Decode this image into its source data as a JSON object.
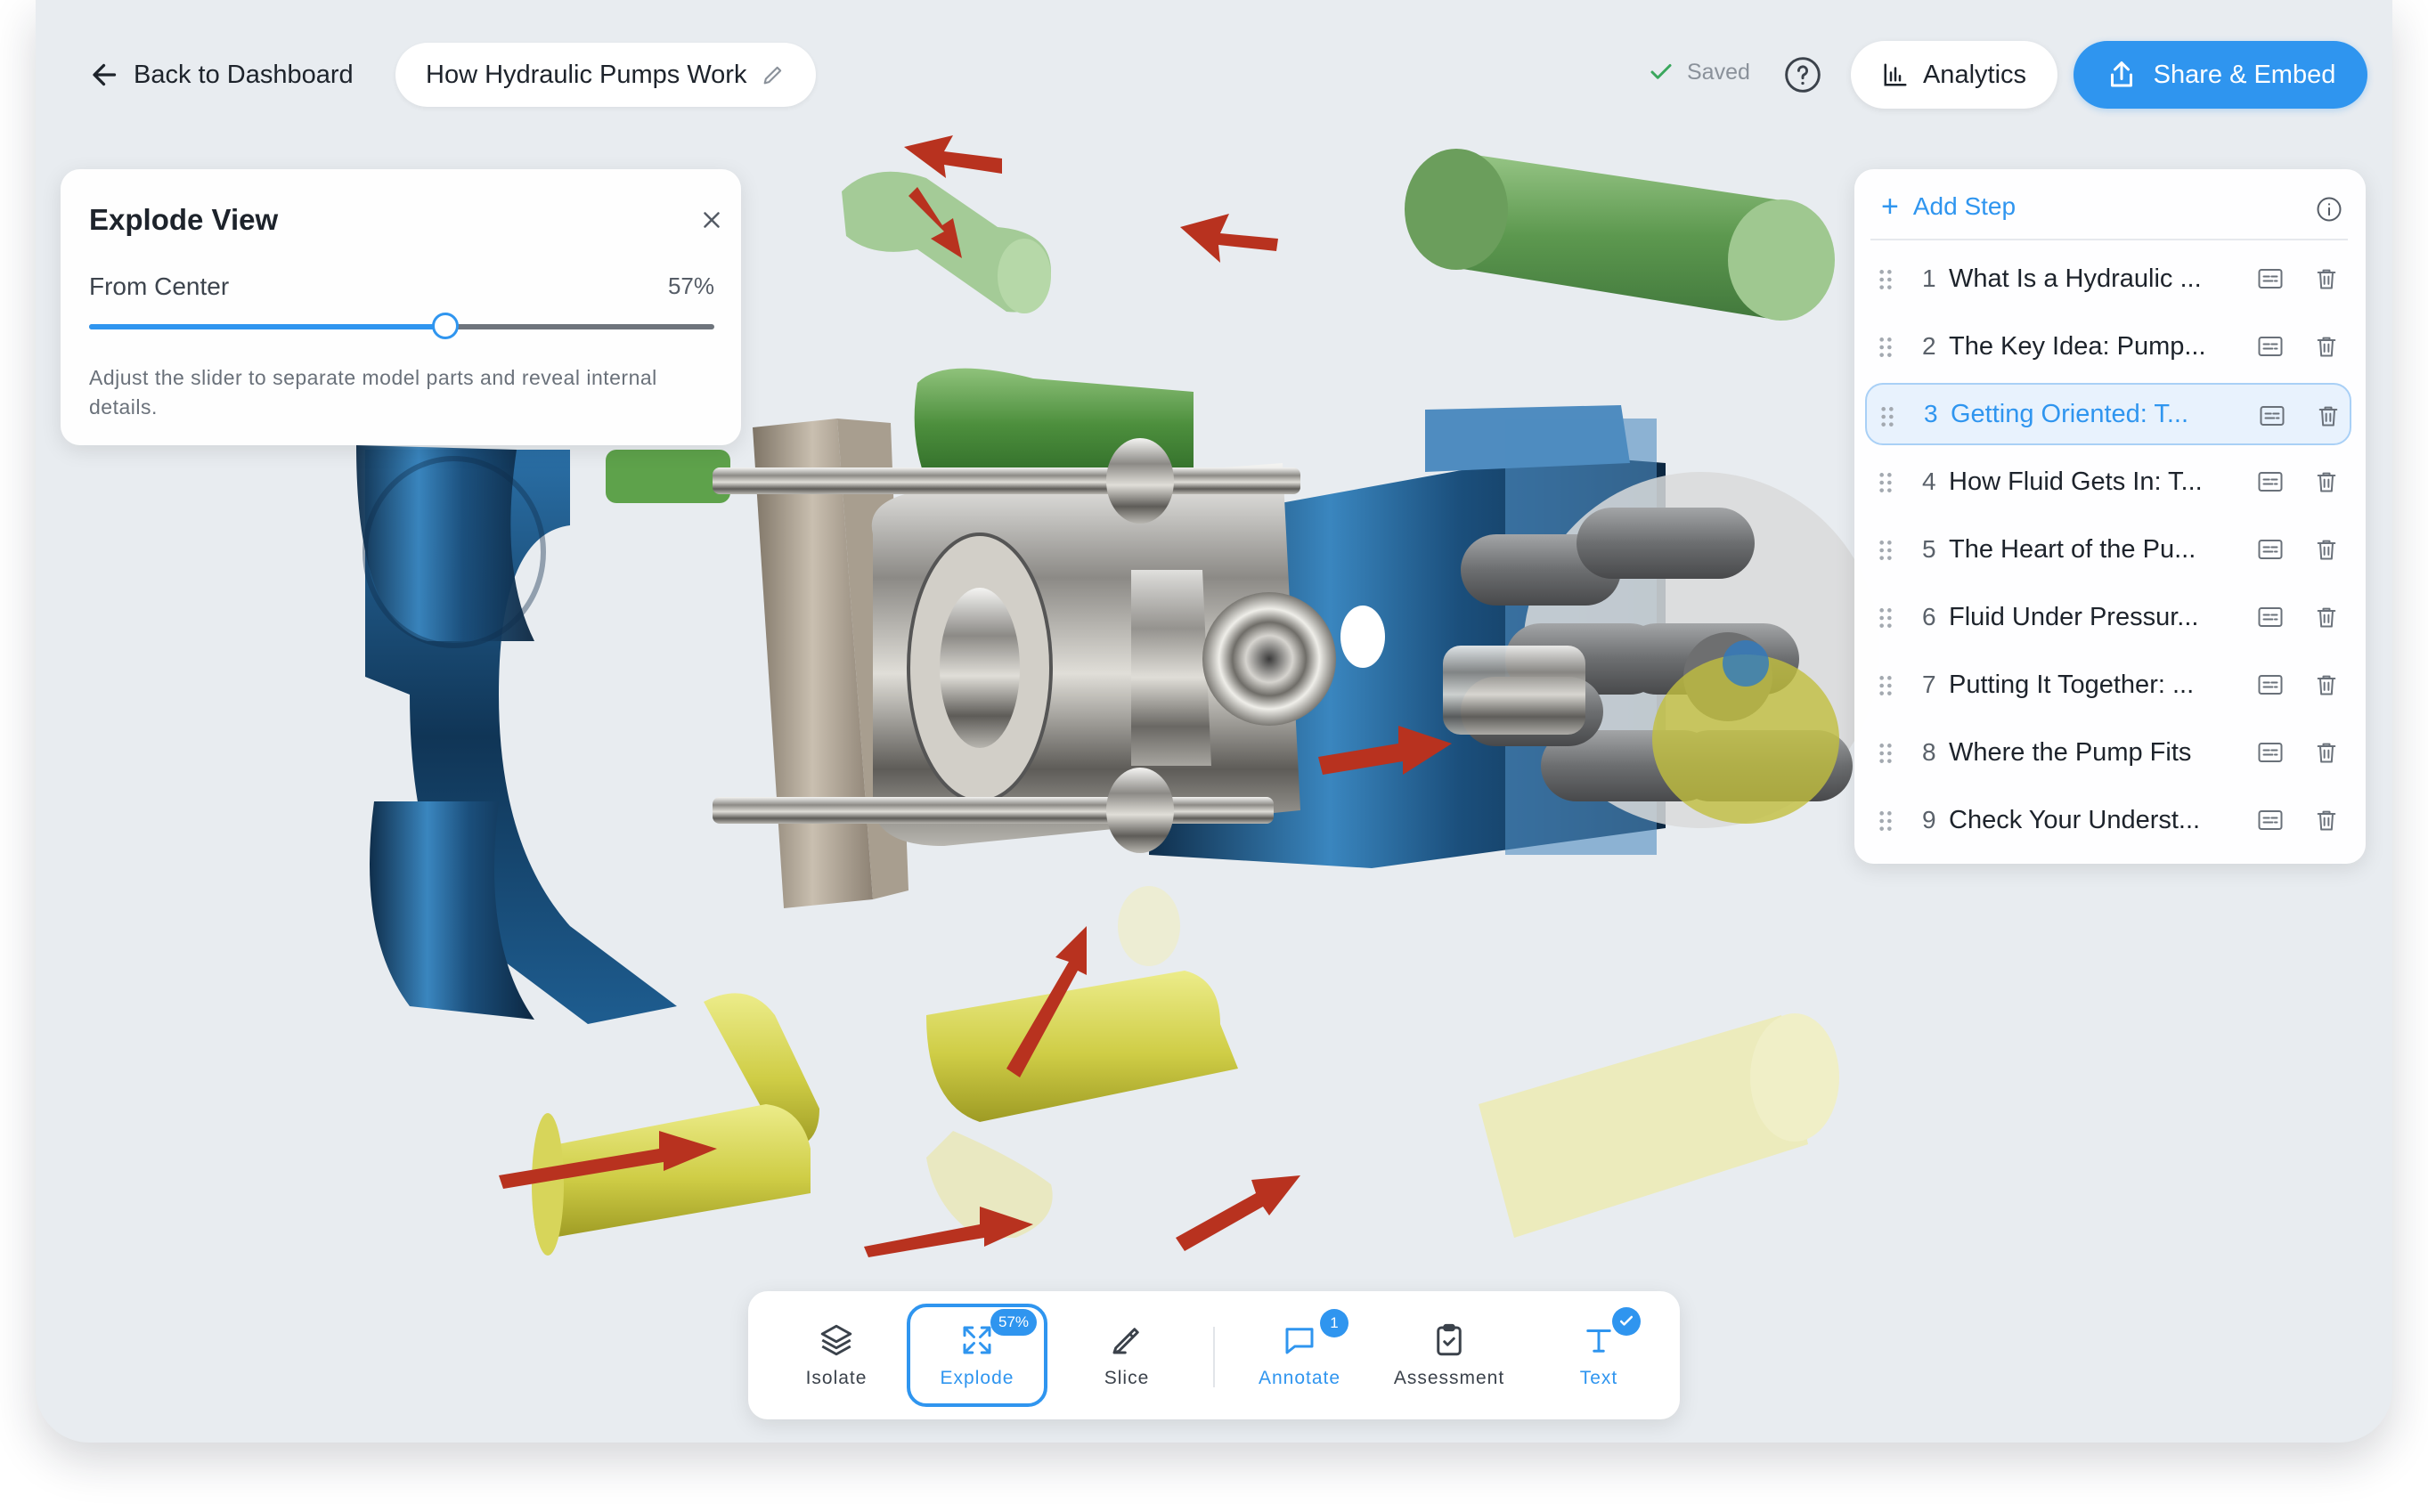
{
  "header": {
    "back_label": "Back to Dashboard",
    "project_title": "How Hydraulic Pumps Work",
    "saved_label": "Saved",
    "analytics_label": "Analytics",
    "share_label": "Share & Embed"
  },
  "explode_panel": {
    "title": "Explode View",
    "mode_label": "From Center",
    "value_text": "57%",
    "value": 0.57,
    "description": "Adjust the slider to separate model parts and reveal internal details."
  },
  "steps_panel": {
    "add_label": "Add Step",
    "steps": [
      {
        "num": "1",
        "label": "What Is a Hydraulic ..."
      },
      {
        "num": "2",
        "label": "The Key Idea: Pump..."
      },
      {
        "num": "3",
        "label": "Getting Oriented: T..."
      },
      {
        "num": "4",
        "label": "How Fluid Gets In: T..."
      },
      {
        "num": "5",
        "label": "The Heart of the Pu..."
      },
      {
        "num": "6",
        "label": "Fluid Under Pressur..."
      },
      {
        "num": "7",
        "label": "Putting It Together: ..."
      },
      {
        "num": "8",
        "label": "Where the Pump Fits"
      },
      {
        "num": "9",
        "label": "Check Your Underst..."
      }
    ],
    "active_index": 2
  },
  "toolbar": {
    "isolate": "Isolate",
    "explode": "Explode",
    "explode_badge": "57%",
    "slice": "Slice",
    "annotate": "Annotate",
    "annotate_badge": "1",
    "assessment": "Assessment",
    "text": "Text"
  },
  "colors": {
    "accent": "#2f95ef",
    "canvas": "#e8ecf0",
    "housing_blue": "#1d5b8c",
    "part_green": "#5a9a4a",
    "part_yellow": "#d8d65a",
    "arrow_red": "#b8321f",
    "metal": "#8b8f93"
  }
}
